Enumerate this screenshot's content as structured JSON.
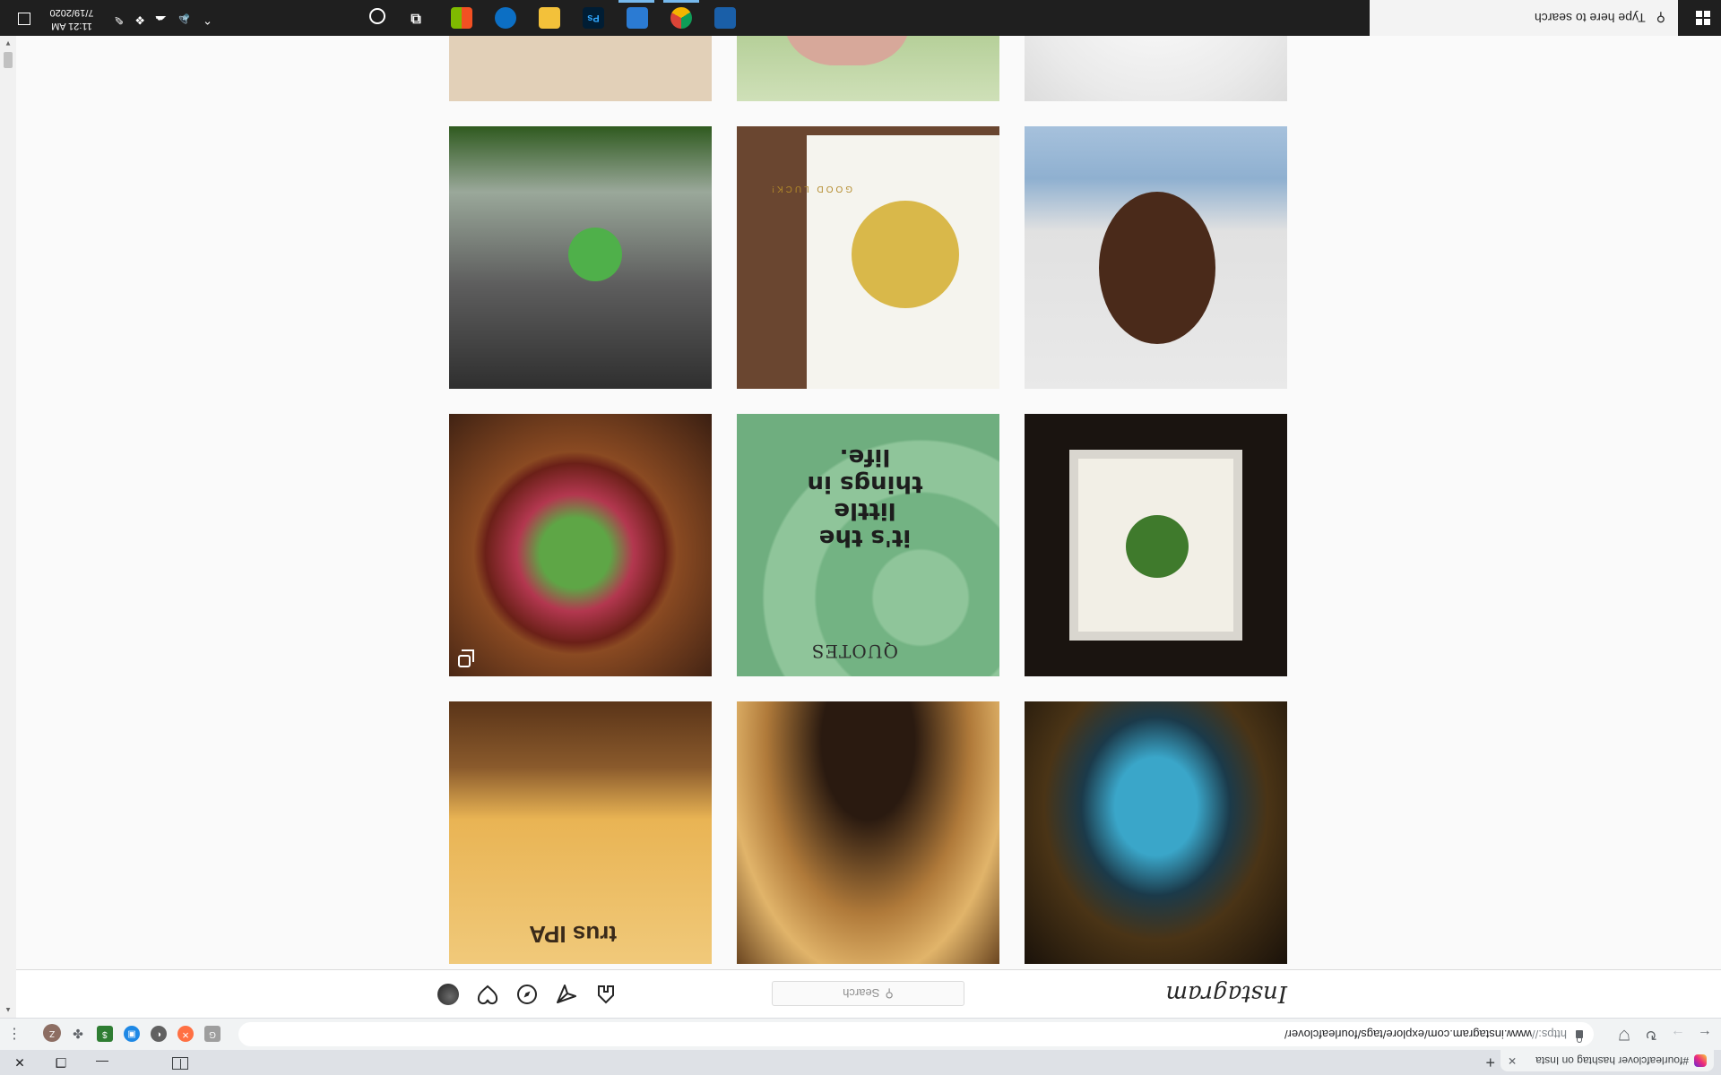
{
  "browser": {
    "tab_title": "#fourleafclover hashtag on Insta",
    "tab_close": "✕",
    "new_tab": "+",
    "url_scheme": "https://",
    "url_rest": "www.instagram.com/explore/tags/fourleafclover/",
    "profile_initial": "Z",
    "window_controls": {
      "minimize": "—",
      "maximize": "❐",
      "close": "✕"
    }
  },
  "instagram": {
    "logo": "Instagram",
    "search_placeholder": "Search",
    "search_icon": "⚲",
    "nav_icons": [
      "home-icon",
      "direct-icon",
      "explore-icon",
      "activity-icon",
      "profile-avatar"
    ]
  },
  "grid": {
    "rows": [
      [
        "cube-gift-boxes",
        "hand-holding-clover",
        "clover-on-white-fabric"
      ],
      [
        "clover-in-hand-forest",
        "good-luck-card",
        "smiling-person-portrait"
      ],
      [
        "clover-resin-paperweight",
        "clover-quote",
        "framed-pressed-clover"
      ],
      [
        "citrus-ipa-beer",
        "blurred-lights",
        "framed-clover-blue"
      ]
    ],
    "card_text": "GOOD LUCK!",
    "quote_title": "QUOTES",
    "quote_text": "it's the little things in life.",
    "beer_text": "trus IPA"
  },
  "taskbar": {
    "search_placeholder": "Type here to search",
    "time": "11:21 AM",
    "date": "7/19/2020",
    "apps": [
      "cortana-icon",
      "task-view-icon",
      "store-icon",
      "edge-icon",
      "file-explorer-icon",
      "photoshop-icon",
      "cloud-app-icon",
      "chrome-icon",
      "control-panel-icon"
    ],
    "photoshop_label": "Ps"
  },
  "colors": {
    "ig_background": "#fafafa",
    "taskbar": "#1f1f1f",
    "chrome_tabstrip": "#dee1e6"
  }
}
